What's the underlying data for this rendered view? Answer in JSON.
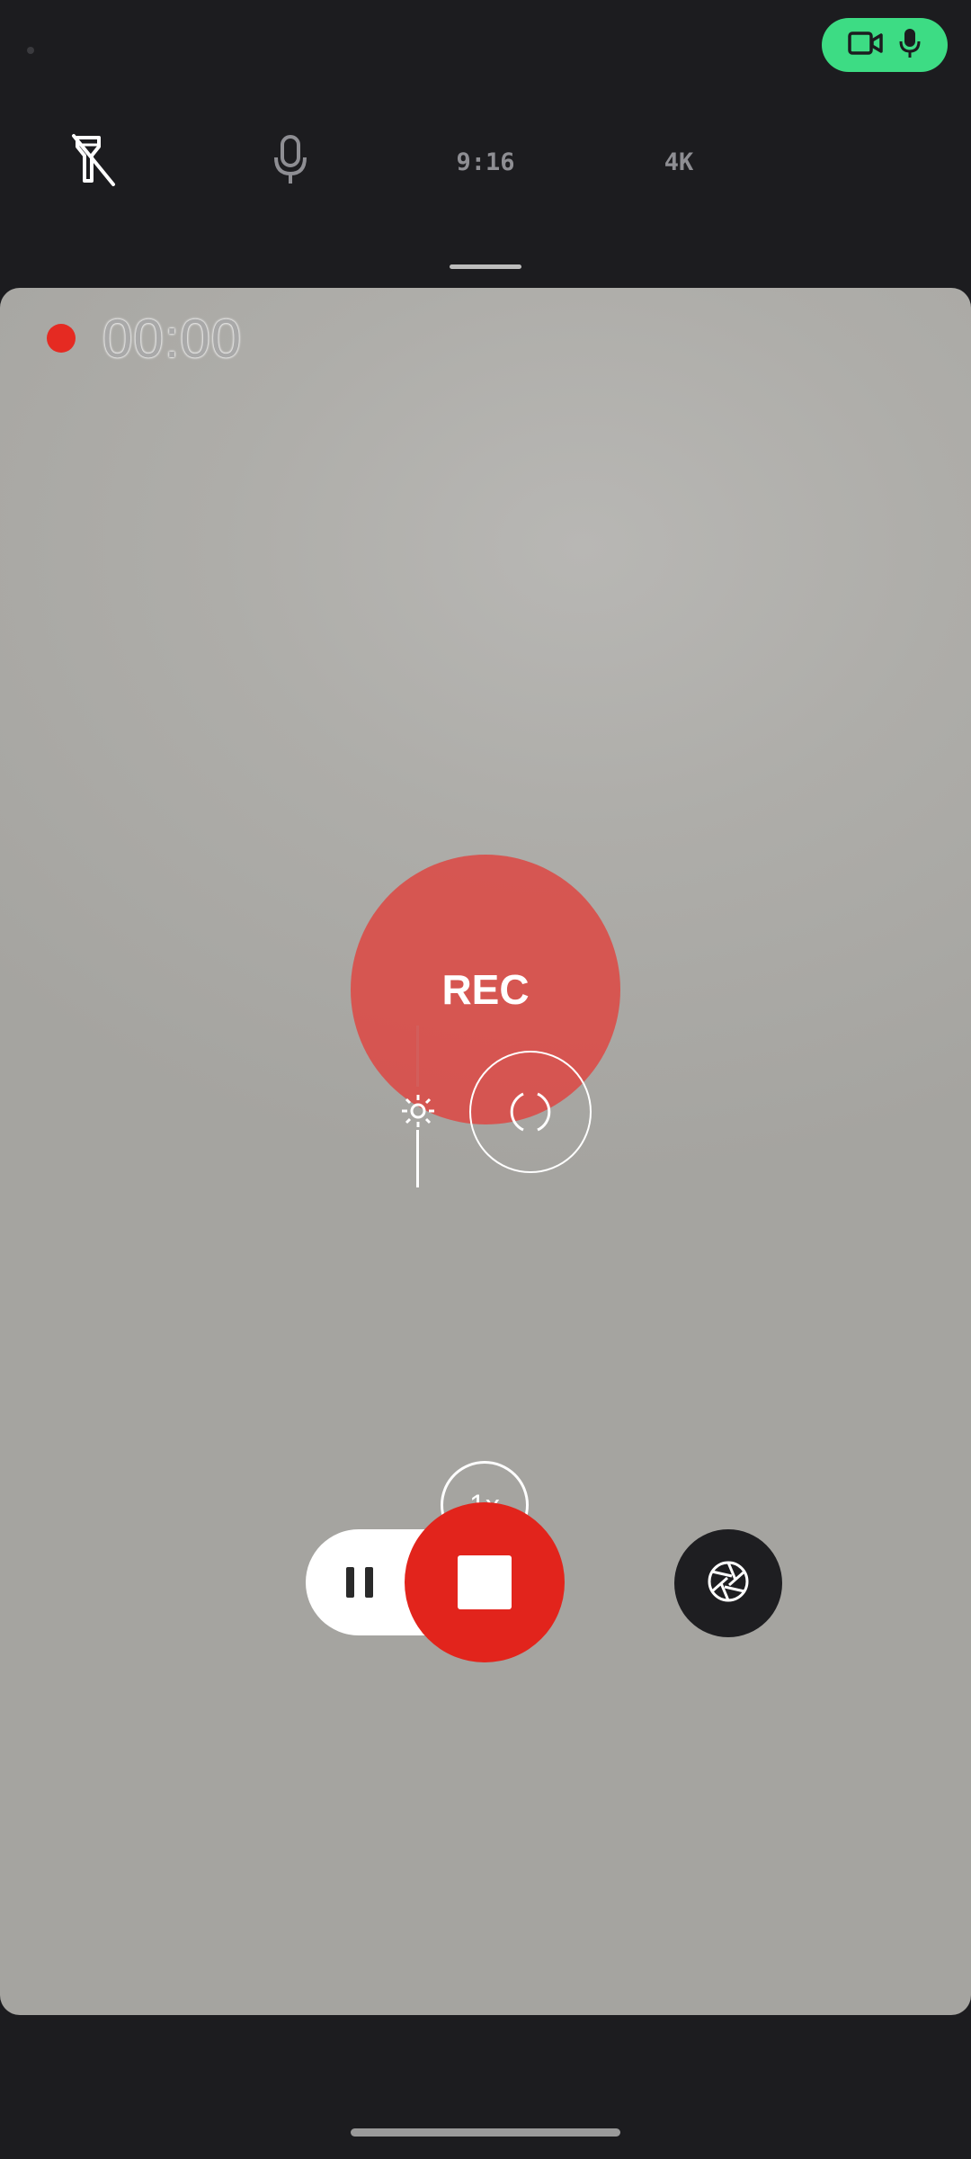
{
  "status_bar": {
    "privacy_indicator_icons": [
      "camera-icon",
      "mic-icon"
    ],
    "accent_color": "#3ddc84"
  },
  "toolbar": {
    "flashlight_icon": "flashlight-off-icon",
    "mic_icon": "mic-icon",
    "aspect_ratio_label": "9:16",
    "resolution_label": "4K"
  },
  "viewfinder": {
    "timer": "00:00",
    "rec_label": "REC",
    "zoom_label": "1x",
    "exposure_icon": "brightness-icon",
    "focus_icon": "focus-ring-icon"
  },
  "controls": {
    "pause_icon": "pause-icon",
    "stop_icon": "stop-icon",
    "snapshot_icon": "shutter-aperture-icon",
    "record_color": "#e2241c"
  }
}
